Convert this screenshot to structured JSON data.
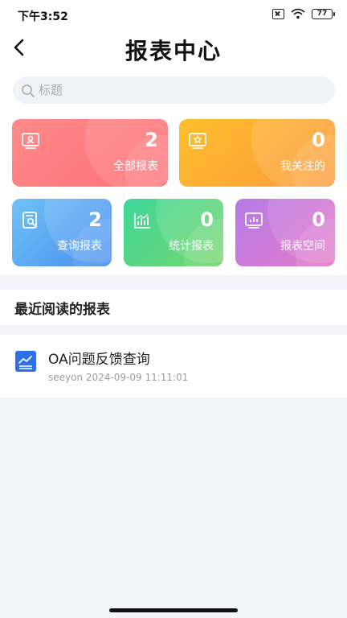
{
  "status_bar": {
    "time": "下午3:52",
    "battery": "77"
  },
  "header": {
    "title": "报表中心"
  },
  "search": {
    "placeholder": "标题"
  },
  "cards": [
    {
      "count": "2",
      "label": "全部报表",
      "icon": "report-card-icon",
      "color": "#fd7b7e"
    },
    {
      "count": "0",
      "label": "我关注的",
      "icon": "star-board-icon",
      "color": "#fdaa33"
    },
    {
      "count": "2",
      "label": "查询报表",
      "icon": "search-doc-icon",
      "color": "#5aa8f3"
    },
    {
      "count": "0",
      "label": "统计报表",
      "icon": "bar-chart-icon",
      "color": "#55d684"
    },
    {
      "count": "0",
      "label": "报表空间",
      "icon": "folder-chart-icon",
      "color": "#cf7bd8"
    }
  ],
  "recent": {
    "title": "最近阅读的报表",
    "items": [
      {
        "title": "OA问题反馈查询",
        "author": "seeyon",
        "datetime": "2024-09-09 11:11:01",
        "icon": "line-chart-icon"
      }
    ]
  }
}
